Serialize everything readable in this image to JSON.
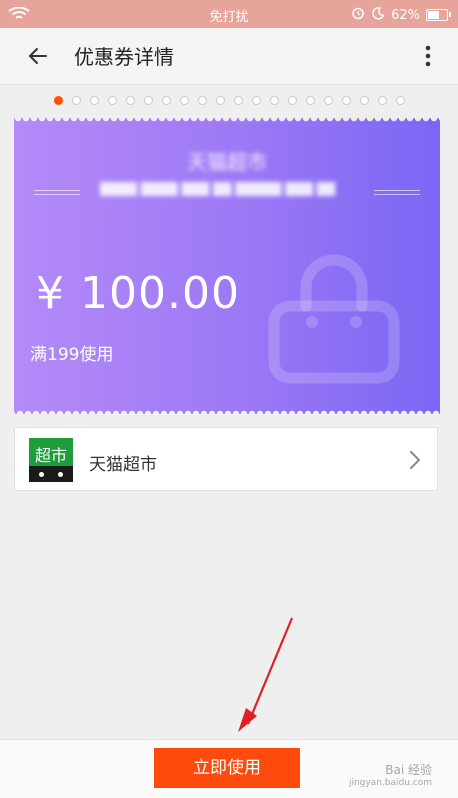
{
  "status_bar": {
    "center_label": "免打扰",
    "battery_percent_label": "62%",
    "battery_level": 0.62,
    "icons": [
      "wifi-icon",
      "alarm-icon",
      "moon-icon",
      "battery-icon"
    ]
  },
  "app_bar": {
    "title": "优惠券详情",
    "icons": [
      "back-arrow-icon",
      "more-vertical-icon"
    ]
  },
  "pager": {
    "count": 20,
    "active_index": 0,
    "active_color": "#ff5000"
  },
  "coupon": {
    "store_title": "天猫超市",
    "subtitle": "████ ████ ███ ██ █████ ███ ██",
    "amount": "¥ 100.00",
    "condition": "满199使用",
    "icons": [
      "shopping-bag-icon"
    ],
    "gradient_colors": [
      "#b48af7",
      "#7b66f4"
    ]
  },
  "store": {
    "logo_text": "超市",
    "name": "天猫超市",
    "icons": [
      "chevron-right-icon"
    ]
  },
  "action": {
    "use_button_label": "立即使用",
    "button_color": "#ff4a0d"
  },
  "watermark": {
    "line1": "Bai 经验",
    "line2": "jingyan.baidu.com"
  }
}
